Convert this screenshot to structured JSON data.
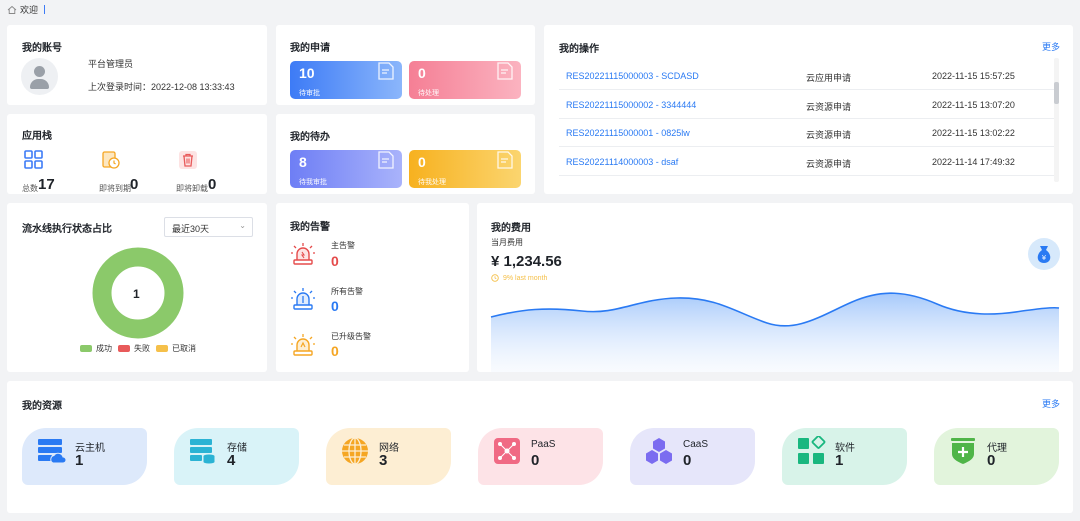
{
  "breadcrumb": {
    "label": "欢迎"
  },
  "account": {
    "title": "我的账号",
    "role": "平台管理员",
    "last_login": "上次登录时间：2022-12-08 13:33:43"
  },
  "app_stack": {
    "title": "应用栈",
    "items": [
      {
        "label": "总数",
        "value": "17",
        "icon": "app-grid-icon",
        "color": "#3d7bf6"
      },
      {
        "label": "即将到期",
        "value": "0",
        "icon": "expiring-icon",
        "color": "#f5a623"
      },
      {
        "label": "即将卸载",
        "value": "0",
        "icon": "trash-icon",
        "color": "#e85a5a"
      }
    ]
  },
  "applications": {
    "title": "我的申请",
    "boxes": [
      {
        "value": "10",
        "label": "待审批"
      },
      {
        "value": "0",
        "label": "待处理"
      }
    ]
  },
  "todos": {
    "title": "我的待办",
    "boxes": [
      {
        "value": "8",
        "label": "待我审批"
      },
      {
        "value": "0",
        "label": "待我处理"
      }
    ]
  },
  "operations": {
    "title": "我的操作",
    "more": "更多",
    "rows": [
      {
        "id": "RES20221115000003 - SCDASD",
        "type": "云应用申请",
        "time": "2022-11-15 15:57:25"
      },
      {
        "id": "RES20221115000002 - 3344444",
        "type": "云资源申请",
        "time": "2022-11-15 13:07:20"
      },
      {
        "id": "RES20221115000001 - 0825lw",
        "type": "云资源申请",
        "time": "2022-11-15 13:02:22"
      },
      {
        "id": "RES20221114000003 - dsaf",
        "type": "云资源申请",
        "time": "2022-11-14 17:49:32"
      }
    ]
  },
  "pipeline": {
    "title": "流水线执行状态占比",
    "range": "最近30天",
    "center": "1",
    "legend": [
      {
        "label": "成功",
        "color": "#8bc96a"
      },
      {
        "label": "失败",
        "color": "#e85a5a"
      },
      {
        "label": "已取消",
        "color": "#f5c04a"
      }
    ]
  },
  "alerts": {
    "title": "我的告警",
    "items": [
      {
        "label": "主告警",
        "value": "0",
        "color": "#e54b4b"
      },
      {
        "label": "所有告警",
        "value": "0",
        "color": "#2a7af3"
      },
      {
        "label": "已升级告警",
        "value": "0",
        "color": "#f5a623"
      }
    ]
  },
  "cost": {
    "title": "我的费用",
    "subtitle": "当月费用",
    "amount": "¥ 1,234.56",
    "trend": "9% last month"
  },
  "resources": {
    "title": "我的资源",
    "more": "更多",
    "items": [
      {
        "label": "云主机",
        "value": "1",
        "icon": "cloud-host-icon",
        "bg": "#dde9fb",
        "color": "#2a7af3"
      },
      {
        "label": "存储",
        "value": "4",
        "icon": "storage-icon",
        "bg": "#d9f3f8",
        "color": "#2bb3d4"
      },
      {
        "label": "网络",
        "value": "3",
        "icon": "network-icon",
        "bg": "#fdeed3",
        "color": "#f5a623"
      },
      {
        "label": "PaaS",
        "value": "0",
        "icon": "paas-icon",
        "bg": "#fde3e7",
        "color": "#f06a84"
      },
      {
        "label": "CaaS",
        "value": "0",
        "icon": "caas-icon",
        "bg": "#e6e6fa",
        "color": "#7b6cf0"
      },
      {
        "label": "软件",
        "value": "1",
        "icon": "software-icon",
        "bg": "#d8f3e9",
        "color": "#19b77f"
      },
      {
        "label": "代理",
        "value": "0",
        "icon": "proxy-icon",
        "bg": "#e2f4dc",
        "color": "#4fb548"
      }
    ]
  }
}
